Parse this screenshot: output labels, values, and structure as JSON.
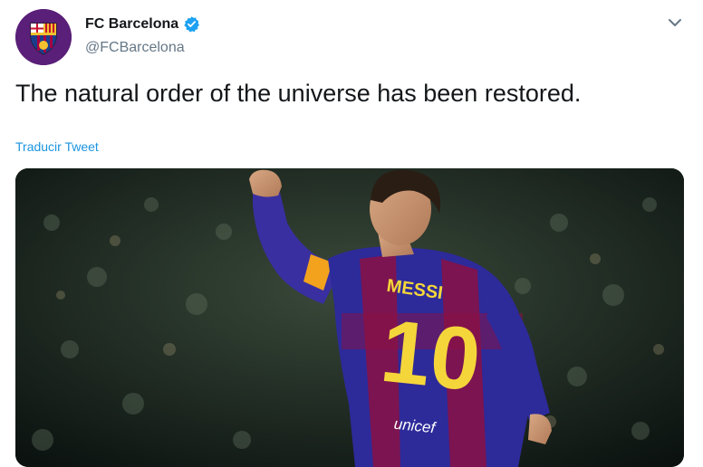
{
  "author": {
    "name": "FC Barcelona",
    "handle": "@FCBarcelona",
    "verified_icon": "verified-badge-icon",
    "avatar_icon": "fc-barcelona-crest-icon"
  },
  "menu_icon": "chevron-down-icon",
  "tweet": {
    "text": "The natural order of the universe has been restored.",
    "translate_label": "Traducir Tweet"
  },
  "media": {
    "jersey_name": "MESSI",
    "jersey_number": "10",
    "sponsor": "unicef"
  },
  "colors": {
    "text": "#14171a",
    "secondary": "#657786",
    "link": "#1b95e0",
    "verified": "#1da1f2",
    "club_purple": "#5a1f78"
  }
}
